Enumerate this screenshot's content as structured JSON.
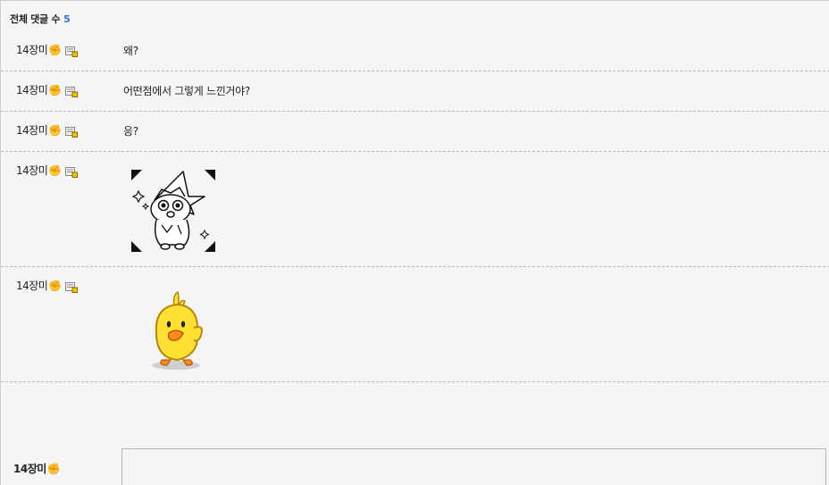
{
  "header": {
    "label": "전체 댓글 수",
    "count": "5"
  },
  "comments": [
    {
      "author": "14장미",
      "text": "왜?"
    },
    {
      "author": "14장미",
      "text": "어떤점에서 그렇게 느낀거야?"
    },
    {
      "author": "14장미",
      "text": "응?"
    },
    {
      "author": "14장미",
      "sticker": "witch-character-sticker"
    },
    {
      "author": "14장미",
      "sticker": "yellow-chick-sticker"
    }
  ],
  "composer": {
    "author": "14장미",
    "placeholder": ""
  },
  "icons": {
    "fist": "✊",
    "memo": "memo-icon"
  },
  "colors": {
    "count_accent": "#3a6fd8",
    "chick_yellow": "#ffe033"
  }
}
